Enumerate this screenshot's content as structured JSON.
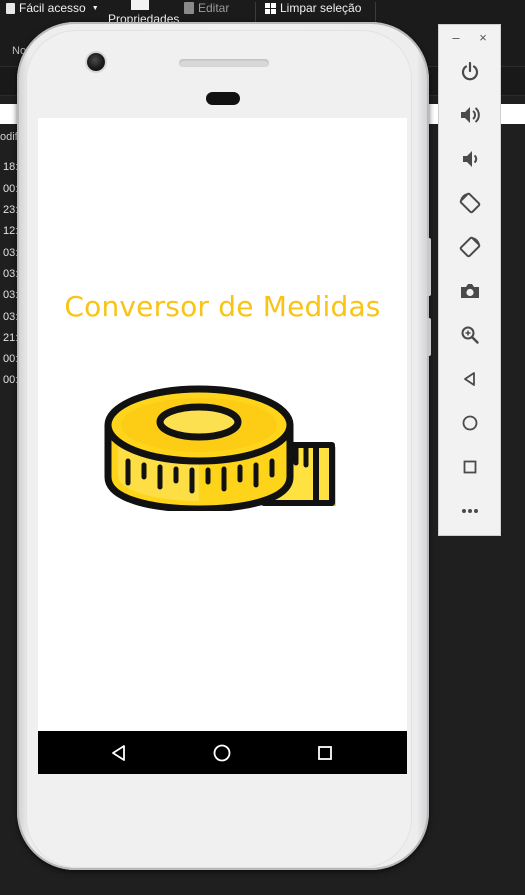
{
  "explorer": {
    "ribbon": {
      "quick_access_label": "Fácil acesso",
      "properties_label": "Propriedades",
      "edit_label": "Editar",
      "clear_selection_label": "Limpar seleção"
    },
    "nav_label": "No",
    "column_header": "odif",
    "file_times": [
      "18:",
      "00:",
      "23:",
      "12:",
      "03:",
      "03:",
      "03:",
      "03:",
      "21:",
      "00:",
      "00:"
    ]
  },
  "app": {
    "title": "Conversor de Medidas",
    "title_color": "#f9c416",
    "icon": "measuring-tape-icon"
  },
  "android_nav": {
    "back_icon": "back-triangle-icon",
    "home_icon": "home-circle-icon",
    "recents_icon": "recents-square-icon"
  },
  "emulator_toolbar": {
    "window_buttons": [
      "minimize-icon",
      "close-icon"
    ],
    "minimize_glyph": "–",
    "close_glyph": "×",
    "tools": [
      "power-icon",
      "volume-up-icon",
      "volume-down-icon",
      "rotate-left-icon",
      "rotate-right-icon",
      "camera-icon",
      "zoom-icon",
      "back-icon",
      "home-icon",
      "overview-icon",
      "more-icon"
    ]
  }
}
